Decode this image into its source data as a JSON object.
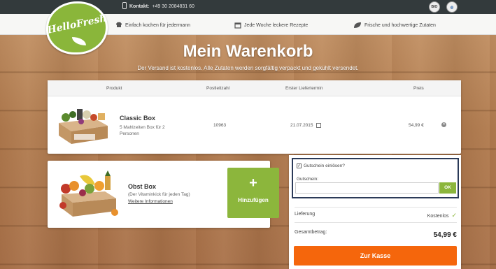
{
  "topbar": {
    "contact_label": "Kontakt:",
    "phone": "+49 30 2084831 60",
    "badges": [
      "BIO",
      "e"
    ]
  },
  "nav": {
    "logo_text": "HelloFresh",
    "items": [
      {
        "icon": "chef-hat-icon",
        "label": "Einfach kochen für jedermann"
      },
      {
        "icon": "calendar-icon",
        "label": "Jede Woche leckere Rezepte"
      },
      {
        "icon": "leaf-icon",
        "label": "Frische und hochwertige Zutaten"
      }
    ]
  },
  "header": {
    "title": "Mein Warenkorb",
    "subtitle": "Der Versand ist kostenlos. Alle Zutaten werden sorgfältig verpackt und gekühlt versendet."
  },
  "cart": {
    "columns": [
      "Produkt",
      "Postleitzahl",
      "Erster Liefertermin",
      "Preis"
    ],
    "item": {
      "name": "Classic Box",
      "description": "5 Mahlzeiten Box für 2 Personen",
      "zip": "10963",
      "date": "21.07.2015",
      "price": "54,99 €"
    }
  },
  "upsell": {
    "name": "Obst Box",
    "description": "(Der Vitaminkick für jeden Tag)",
    "link": "Weitere Informationen",
    "button_plus": "+",
    "button_label": "Hinzufügen"
  },
  "summary": {
    "voucher_checkbox_label": "Gutschein einlösen?",
    "voucher_checked": true,
    "voucher_field_label": "Gutschein:",
    "voucher_placeholder": "",
    "ok_label": "OK",
    "delivery_label": "Lieferung",
    "delivery_value": "Kostenlos",
    "total_label": "Gesamtbetrag:",
    "total_value": "54,99 €",
    "checkout_label": "Zur Kasse"
  },
  "colors": {
    "green": "#8cb63c",
    "orange": "#f5660c",
    "topbar": "#333a3c",
    "voucher_border": "#2b3a58"
  }
}
